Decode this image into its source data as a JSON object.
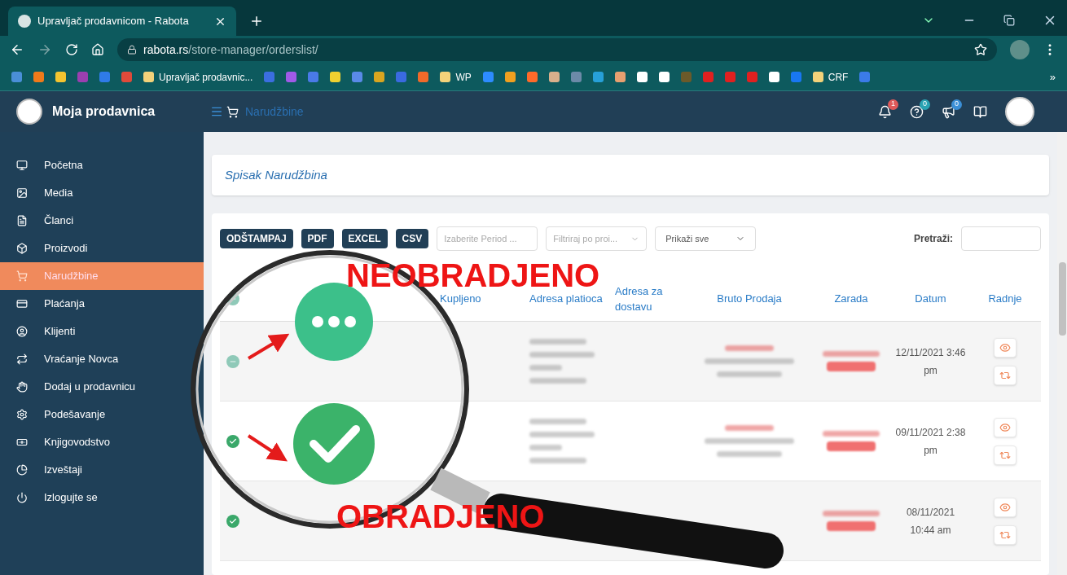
{
  "browser": {
    "tab_title": "Upravljač prodavnicom - Rabota",
    "url_domain": "rabota.rs",
    "url_path": "/store-manager/orderslist/",
    "bookmarks": [
      {
        "kind": "icon"
      },
      {
        "kind": "icon"
      },
      {
        "kind": "icon"
      },
      {
        "kind": "icon"
      },
      {
        "kind": "icon"
      },
      {
        "kind": "icon"
      },
      {
        "kind": "labeled",
        "label": "Upravljač prodavnic..."
      },
      {
        "kind": "icon"
      },
      {
        "kind": "icon"
      },
      {
        "kind": "icon"
      },
      {
        "kind": "icon"
      },
      {
        "kind": "icon"
      },
      {
        "kind": "icon"
      },
      {
        "kind": "icon"
      },
      {
        "kind": "icon"
      },
      {
        "kind": "labeled",
        "label": "WP"
      },
      {
        "kind": "icon"
      },
      {
        "kind": "icon"
      },
      {
        "kind": "icon"
      },
      {
        "kind": "icon"
      },
      {
        "kind": "icon"
      },
      {
        "kind": "icon"
      },
      {
        "kind": "icon"
      },
      {
        "kind": "icon"
      },
      {
        "kind": "icon"
      },
      {
        "kind": "icon"
      },
      {
        "kind": "icon"
      },
      {
        "kind": "icon"
      },
      {
        "kind": "icon"
      },
      {
        "kind": "icon"
      },
      {
        "kind": "icon"
      },
      {
        "kind": "labeled",
        "label": "CRF"
      },
      {
        "kind": "icon"
      }
    ],
    "overflow": "»"
  },
  "header": {
    "brand": "Moja prodavnica",
    "breadcrumb": "Narudžbine",
    "badges": [
      {
        "count": "1",
        "color": "#e05a5a"
      },
      {
        "count": "0",
        "color": "#2aa3b3"
      },
      {
        "count": "0",
        "color": "#3b8fd6"
      }
    ]
  },
  "sidebar": {
    "items": [
      {
        "label": "Početna",
        "selected": false
      },
      {
        "label": "Media",
        "selected": false
      },
      {
        "label": "Članci",
        "selected": false
      },
      {
        "label": "Proizvodi",
        "selected": false
      },
      {
        "label": "Narudžbine",
        "selected": true
      },
      {
        "label": "Plaćanja",
        "selected": false
      },
      {
        "label": "Klijenti",
        "selected": false
      },
      {
        "label": "Vraćanje Novca",
        "selected": false
      },
      {
        "label": "Dodaj u prodavnicu",
        "selected": false
      },
      {
        "label": "Podešavanje",
        "selected": false
      },
      {
        "label": "Knjigovodstvo",
        "selected": false
      },
      {
        "label": "Izveštaji",
        "selected": false
      },
      {
        "label": "Izlogujte se",
        "selected": false
      }
    ]
  },
  "page_title": "Spisak Narudžbina",
  "toolbar": {
    "buttons": [
      "ODŠTAMPAJ",
      "PDF",
      "EXCEL",
      "CSV"
    ],
    "period": {
      "placeholder": "Izaberite Period ..."
    },
    "product_filter": {
      "placeholder": "Filtriraj po proi..."
    },
    "show_filter": {
      "value": "Prikaži sve"
    },
    "search_label": "Pretraži:"
  },
  "table": {
    "columns": [
      "Kupljeno",
      "Adresa platioca",
      "Adresa za dostavu",
      "Bruto Prodaja",
      "Zarada",
      "Datum",
      "Radnje"
    ],
    "rows": [
      {
        "processed": false,
        "date": "12/11/2021 3:46 pm"
      },
      {
        "processed": true,
        "date": "09/11/2021 2:38 pm"
      },
      {
        "processed": true,
        "date": "08/11/2021 10:44 am"
      }
    ]
  },
  "magnifier": {
    "labels": [
      "NEOBRADJENO",
      "OBRADJENO"
    ]
  }
}
